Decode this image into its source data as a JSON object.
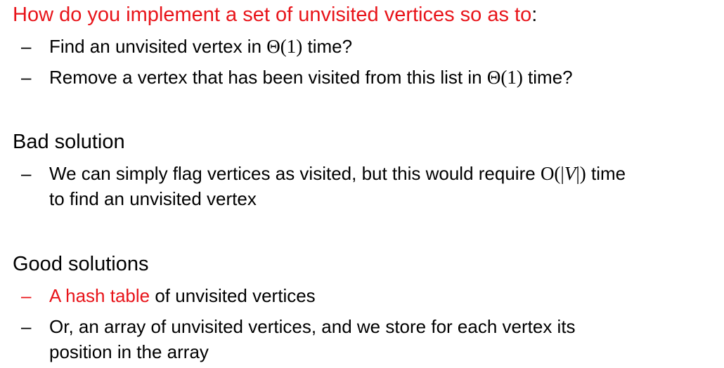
{
  "question": {
    "heading_red": "How do you implement a set of unvisited vertices so as to",
    "heading_colon": ":",
    "items": [
      {
        "dash": "–",
        "before": "Find an unvisited vertex in ",
        "math": "Θ(1)",
        "after": " time?"
      },
      {
        "dash": "–",
        "before": "Remove a vertex that has been visited from this list in ",
        "math": "Θ(1)",
        "after": " time?"
      }
    ]
  },
  "bad": {
    "heading": "Bad solution",
    "item": {
      "dash": "–",
      "before": "We can simply flag vertices as visited, but this would require ",
      "math_open": "O(|",
      "math_var": "V",
      "math_close": "|)",
      "after": " time",
      "line2": "to find an unvisited vertex"
    }
  },
  "good": {
    "heading": "Good solutions",
    "items": [
      {
        "dash": "–",
        "red": "A hash table",
        "rest": " of unvisited vertices"
      },
      {
        "dash": "–",
        "line1": "Or, an array of unvisited vertices, and we store for each vertex its",
        "line2": "position in the array"
      }
    ]
  },
  "colors": {
    "highlight": "#e8141a",
    "text": "#000000",
    "background": "#ffffff"
  }
}
